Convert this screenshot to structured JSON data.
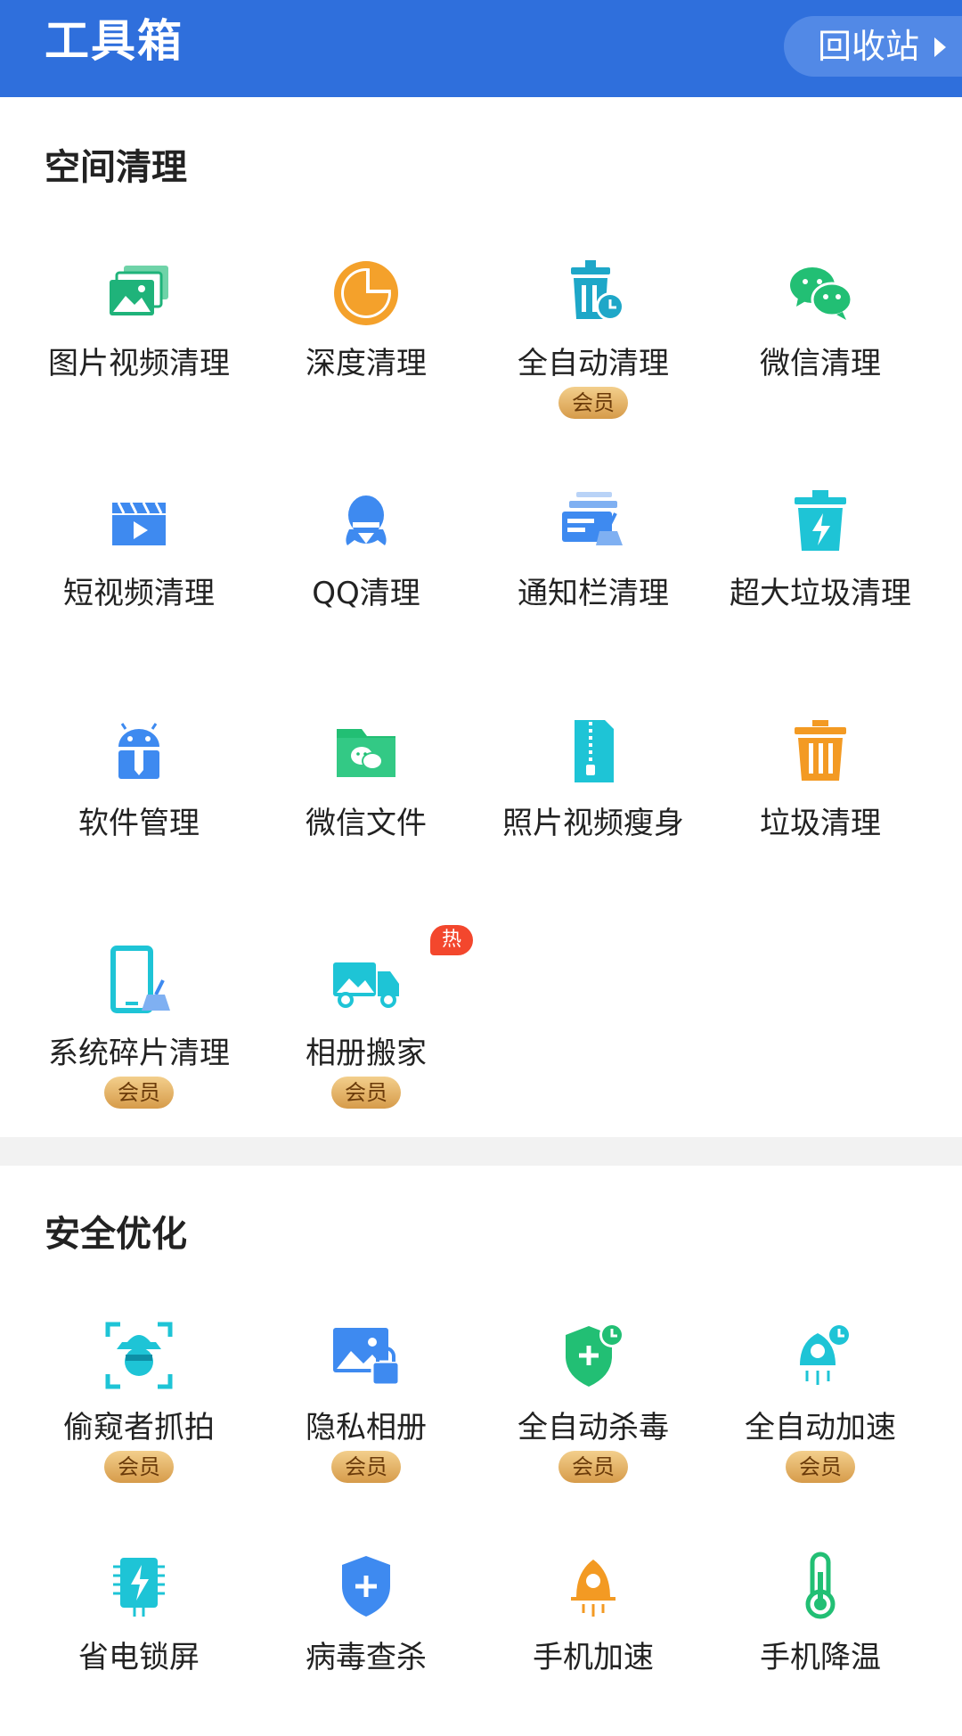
{
  "header": {
    "title": "工具箱",
    "recycle_label": "回收站"
  },
  "sections": [
    {
      "title": "空间清理",
      "items": [
        {
          "label": "图片视频清理",
          "icon": "image-video-icon",
          "badge": ""
        },
        {
          "label": "深度清理",
          "icon": "pie-chart-icon",
          "badge": ""
        },
        {
          "label": "全自动清理",
          "icon": "trash-clock-icon",
          "badge": "会员"
        },
        {
          "label": "微信清理",
          "icon": "wechat-icon",
          "badge": ""
        },
        {
          "label": "短视频清理",
          "icon": "video-clapper-icon",
          "badge": ""
        },
        {
          "label": "QQ清理",
          "icon": "qq-penguin-icon",
          "badge": ""
        },
        {
          "label": "通知栏清理",
          "icon": "notification-broom-icon",
          "badge": ""
        },
        {
          "label": "超大垃圾清理",
          "icon": "trash-bolt-icon",
          "badge": ""
        },
        {
          "label": "软件管理",
          "icon": "android-icon",
          "badge": ""
        },
        {
          "label": "微信文件",
          "icon": "wechat-folder-icon",
          "badge": ""
        },
        {
          "label": "照片视频瘦身",
          "icon": "zip-file-icon",
          "badge": ""
        },
        {
          "label": "垃圾清理",
          "icon": "trash-can-icon",
          "badge": ""
        },
        {
          "label": "系统碎片清理",
          "icon": "phone-broom-icon",
          "badge": "会员"
        },
        {
          "label": "相册搬家",
          "icon": "moving-truck-icon",
          "badge": "会员",
          "hot": "热"
        }
      ]
    },
    {
      "title": "安全优化",
      "items": [
        {
          "label": "偷窥者抓拍",
          "icon": "spy-face-icon",
          "badge": "会员"
        },
        {
          "label": "隐私相册",
          "icon": "photo-lock-icon",
          "badge": "会员"
        },
        {
          "label": "全自动杀毒",
          "icon": "shield-clock-icon",
          "badge": "会员"
        },
        {
          "label": "全自动加速",
          "icon": "rocket-clock-icon",
          "badge": "会员"
        },
        {
          "label": "省电锁屏",
          "icon": "battery-chip-icon",
          "badge": ""
        },
        {
          "label": "病毒查杀",
          "icon": "shield-plus-icon",
          "badge": ""
        },
        {
          "label": "手机加速",
          "icon": "rocket-icon",
          "badge": ""
        },
        {
          "label": "手机降温",
          "icon": "thermometer-icon",
          "badge": ""
        }
      ]
    }
  ]
}
